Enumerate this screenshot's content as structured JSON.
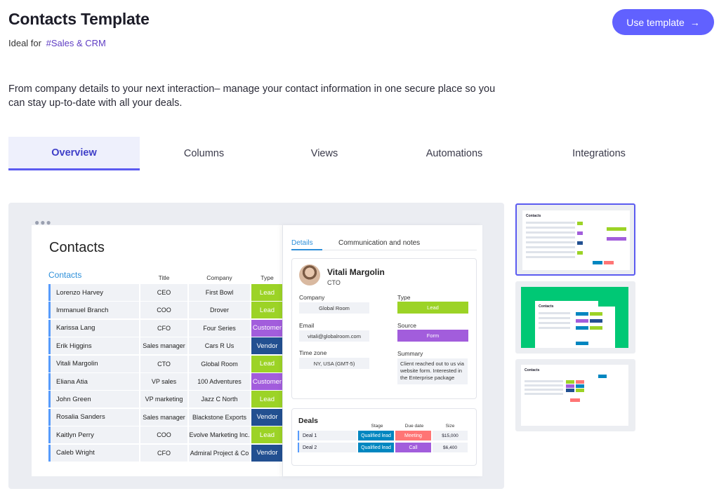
{
  "header": {
    "title": "Contacts Template",
    "ideal_for_label": "Ideal for",
    "ideal_for_tag": "#Sales & CRM",
    "use_template_label": "Use template",
    "use_template_icon": "arrow-right-icon"
  },
  "description": "From company details to your next interaction– manage your contact information in one secure place so you can stay up-to-date with all your deals.",
  "tabs": [
    {
      "label": "Overview",
      "active": true
    },
    {
      "label": "Columns",
      "active": false
    },
    {
      "label": "Views",
      "active": false
    },
    {
      "label": "Automations",
      "active": false
    },
    {
      "label": "Integrations",
      "active": false
    }
  ],
  "preview": {
    "board_title": "Contacts",
    "group_label": "Contacts",
    "columns": [
      "Title",
      "Company",
      "Type"
    ],
    "rows": [
      {
        "name": "Lorenzo Harvey",
        "title": "CEO",
        "company": "First Bowl",
        "type": "Lead",
        "type_color": "#9cd326"
      },
      {
        "name": "Immanuel Branch",
        "title": "COO",
        "company": "Drover",
        "type": "Lead",
        "type_color": "#9cd326"
      },
      {
        "name": "Karissa Lang",
        "title": "CFO",
        "company": "Four Series",
        "type": "Customer",
        "type_color": "#a25ddc"
      },
      {
        "name": "Erik Higgins",
        "title": "Sales manager",
        "company": "Cars R Us",
        "type": "Vendor",
        "type_color": "#225091"
      },
      {
        "name": "Vitali Margolin",
        "title": "CTO",
        "company": "Global Room",
        "type": "Lead",
        "type_color": "#9cd326"
      },
      {
        "name": "Eliana Atia",
        "title": "VP sales",
        "company": "100 Adventures",
        "type": "Customer",
        "type_color": "#a25ddc"
      },
      {
        "name": "John Green",
        "title": "VP marketing",
        "company": "Jazz C North",
        "type": "Lead",
        "type_color": "#9cd326"
      },
      {
        "name": "Rosalia Sanders",
        "title": "Sales manager",
        "company": "Blackstone Exports",
        "type": "Vendor",
        "type_color": "#225091"
      },
      {
        "name": "Kaitlyn Perry",
        "title": "COO",
        "company": "Evolve Marketing Inc.",
        "type": "Lead",
        "type_color": "#9cd326"
      },
      {
        "name": "Caleb Wright",
        "title": "CFO",
        "company": "Admiral Project & Co",
        "type": "Vendor",
        "type_color": "#225091"
      }
    ],
    "panel": {
      "tab_details": "Details",
      "tab_communication": "Communication and notes",
      "person_name": "Vitali Margolin",
      "person_role": "CTO",
      "company_label": "Company",
      "company_value": "Global Room",
      "email_label": "Email",
      "email_value": "vitali@globalroom.com",
      "timezone_label": "Time zone",
      "timezone_value": "NY, USA (GMT-5)",
      "type_label": "Type",
      "type_value": "Lead",
      "type_color": "#9cd326",
      "source_label": "Source",
      "source_value": "Form",
      "source_color": "#a25ddc",
      "summary_label": "Summary",
      "summary_value": "Client reached out to us via website form. Interested in the Enterprise package",
      "deals_title": "Deals",
      "deals_columns": [
        "Stage",
        "Due date",
        "Size"
      ],
      "deals": [
        {
          "name": "Deal 1",
          "stage": "Qualified lead",
          "stage_color": "#0086c0",
          "due": "Meeting",
          "due_color": "#ff7575",
          "size": "$15,000"
        },
        {
          "name": "Deal 2",
          "stage": "Qualified lead",
          "stage_color": "#0086c0",
          "due": "Call",
          "due_color": "#a25ddc",
          "size": "$6,400"
        }
      ]
    }
  },
  "thumbnails": [
    {
      "label": "Contacts",
      "selected": true
    },
    {
      "label": "Contacts",
      "selected": false
    },
    {
      "label": "Contacts",
      "selected": false
    }
  ],
  "colors": {
    "accent": "#6161ff",
    "tag": "#5f3dc4",
    "lead": "#9cd326",
    "customer": "#a25ddc",
    "vendor": "#225091",
    "thumb_green": "#00c875"
  }
}
